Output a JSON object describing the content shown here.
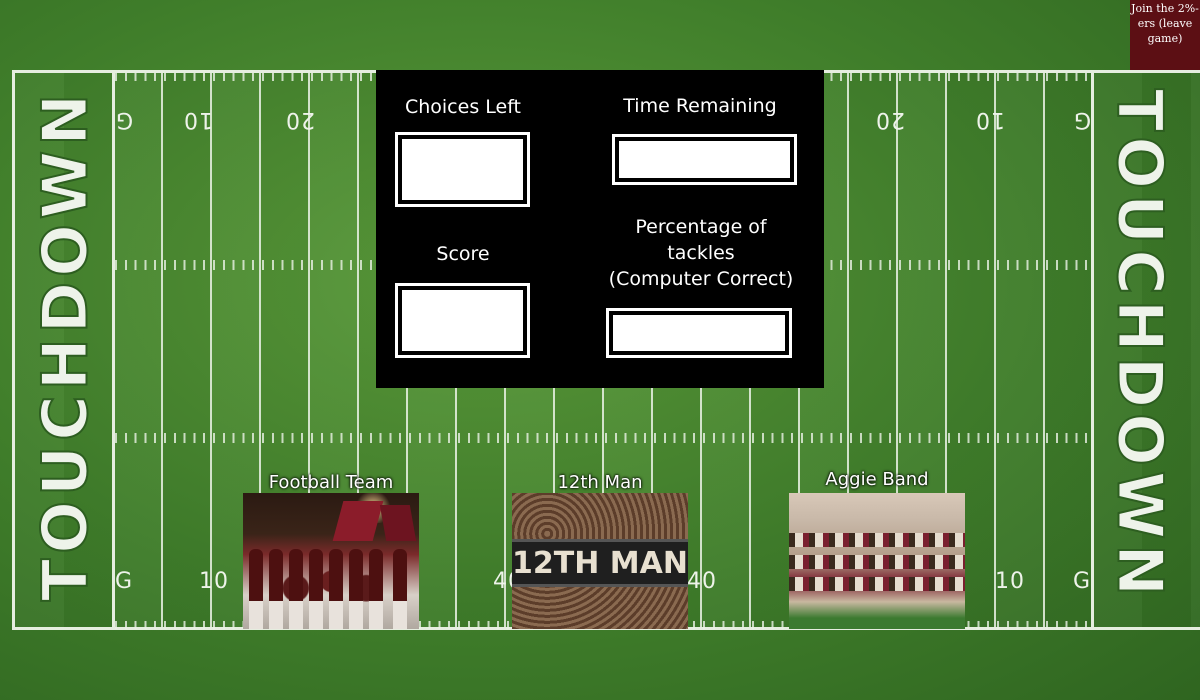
{
  "header": {
    "join_button_label": "Join the 2%-ers (leave game)"
  },
  "field": {
    "endzone_text": "TOUCHDOWN",
    "top_numbers": [
      "G",
      "10",
      "20",
      "20",
      "10",
      "G"
    ],
    "bottom_numbers": [
      "G",
      "10",
      "40",
      "40",
      "10",
      "G"
    ]
  },
  "scoreboard": {
    "choices_left_label": "Choices Left",
    "time_remaining_label": "Time Remaining",
    "score_label": "Score",
    "percentage_label_line1": "Percentage of",
    "percentage_label_line2": "tackles",
    "percentage_label_line3": "(Computer Correct)",
    "choices_left_value": "",
    "time_remaining_value": "",
    "score_value": "",
    "percentage_value": ""
  },
  "choices": [
    {
      "label": "Football Team"
    },
    {
      "label": "12th Man",
      "image_text": "12TH MAN"
    },
    {
      "label": "Aggie Band"
    }
  ],
  "colors": {
    "field_green": "#3f7d2a",
    "maroon": "#5c0f14",
    "scoreboard_bg": "#000000",
    "line_white": "#e6eee0"
  }
}
